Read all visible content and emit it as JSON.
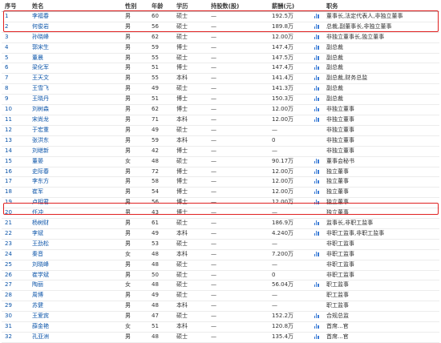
{
  "headers": [
    "序号",
    "姓名",
    "性别",
    "年龄",
    "学历",
    "持股数(股)",
    "薪酬(元)",
    "",
    "职务"
  ],
  "rows": [
    [
      "1",
      "李福春",
      "男",
      "60",
      "硕士",
      "—",
      "192.5万",
      "董事长,法定代表人,非独立董事"
    ],
    [
      "2",
      "何俊岩",
      "男",
      "56",
      "硕士",
      "—",
      "189.8万",
      "总裁,副董事长,非独立董事"
    ],
    [
      "3",
      "孙晓峰",
      "男",
      "62",
      "硕士",
      "—",
      "12.00万",
      "非独立董事长,独立董事"
    ],
    [
      "4",
      "郭宋生",
      "男",
      "59",
      "博士",
      "—",
      "147.4万",
      "副总裁"
    ],
    [
      "5",
      "董晨",
      "男",
      "55",
      "硕士",
      "—",
      "147.5万",
      "副总裁"
    ],
    [
      "6",
      "梁化军",
      "男",
      "51",
      "博士",
      "—",
      "147.4万",
      "副总裁"
    ],
    [
      "7",
      "王天文",
      "男",
      "55",
      "本科",
      "—",
      "141.4万",
      "副总裁,财务总监"
    ],
    [
      "8",
      "王雪飞",
      "男",
      "49",
      "硕士",
      "—",
      "141.3万",
      "副总裁"
    ],
    [
      "9",
      "王晓丹",
      "男",
      "51",
      "博士",
      "—",
      "150.3万",
      "副总裁"
    ],
    [
      "10",
      "刘树森",
      "男",
      "62",
      "博士",
      "—",
      "12.00万",
      "非独立董事"
    ],
    [
      "11",
      "宋尚龙",
      "男",
      "71",
      "本科",
      "—",
      "12.00万",
      "非独立董事"
    ],
    [
      "12",
      "于宏重",
      "男",
      "49",
      "硕士",
      "—",
      "—",
      "非独立董事"
    ],
    [
      "13",
      "张洪东",
      "男",
      "59",
      "本科",
      "—",
      "0",
      "非独立董事"
    ],
    [
      "14",
      "刘继新",
      "男",
      "42",
      "博士",
      "—",
      "—",
      "非独立董事"
    ],
    [
      "15",
      "董晏",
      "女",
      "48",
      "硕士",
      "—",
      "90.17万",
      "董事会秘书"
    ],
    [
      "16",
      "史际春",
      "男",
      "72",
      "博士",
      "—",
      "12.00万",
      "独立董事"
    ],
    [
      "17",
      "李东方",
      "男",
      "58",
      "博士",
      "—",
      "12.00万",
      "独立董事"
    ],
    [
      "18",
      "崔军",
      "男",
      "54",
      "博士",
      "—",
      "12.00万",
      "独立董事"
    ],
    [
      "19",
      "卢相君",
      "男",
      "56",
      "博士",
      "—",
      "12.00万",
      "独立董事"
    ],
    [
      "20",
      "任冲",
      "男",
      "43",
      "博士",
      "—",
      "—",
      "独立董事"
    ],
    [
      "21",
      "杨树财",
      "男",
      "61",
      "硕士",
      "—",
      "186.9万",
      "监事长,非职工监事"
    ],
    [
      "22",
      "李斌",
      "男",
      "49",
      "本科",
      "—",
      "4.240万",
      "非职工监事,非职工监事"
    ],
    [
      "23",
      "王劲松",
      "男",
      "53",
      "硕士",
      "—",
      "—",
      "非职工监事"
    ],
    [
      "24",
      "秦音",
      "女",
      "48",
      "本科",
      "—",
      "7.200万",
      "非职工监事"
    ],
    [
      "25",
      "刘晓峰",
      "男",
      "48",
      "硕士",
      "—",
      "—",
      "非职工监事"
    ],
    [
      "26",
      "崔学斌",
      "男",
      "50",
      "硕士",
      "—",
      "0",
      "非职工监事"
    ],
    [
      "27",
      "陶丽",
      "女",
      "48",
      "硕士",
      "—",
      "56.04万",
      "职工监事"
    ],
    [
      "28",
      "周博",
      "男",
      "49",
      "硕士",
      "—",
      "—",
      "职工监事"
    ],
    [
      "29",
      "苏健",
      "男",
      "48",
      "本科",
      "—",
      "—",
      "职工监事"
    ],
    [
      "30",
      "王爱宾",
      "男",
      "47",
      "硕士",
      "—",
      "152.2万",
      "合规总监"
    ],
    [
      "31",
      "薛金艳",
      "女",
      "51",
      "本科",
      "—",
      "120.8万",
      "首席...官"
    ],
    [
      "32",
      "孔亚洲",
      "男",
      "48",
      "硕士",
      "—",
      "135.4万",
      "首席...官"
    ]
  ],
  "highlight_color": "#e02020",
  "link_color": "#0a53a8",
  "chart_icon": "bar-chart-icon"
}
